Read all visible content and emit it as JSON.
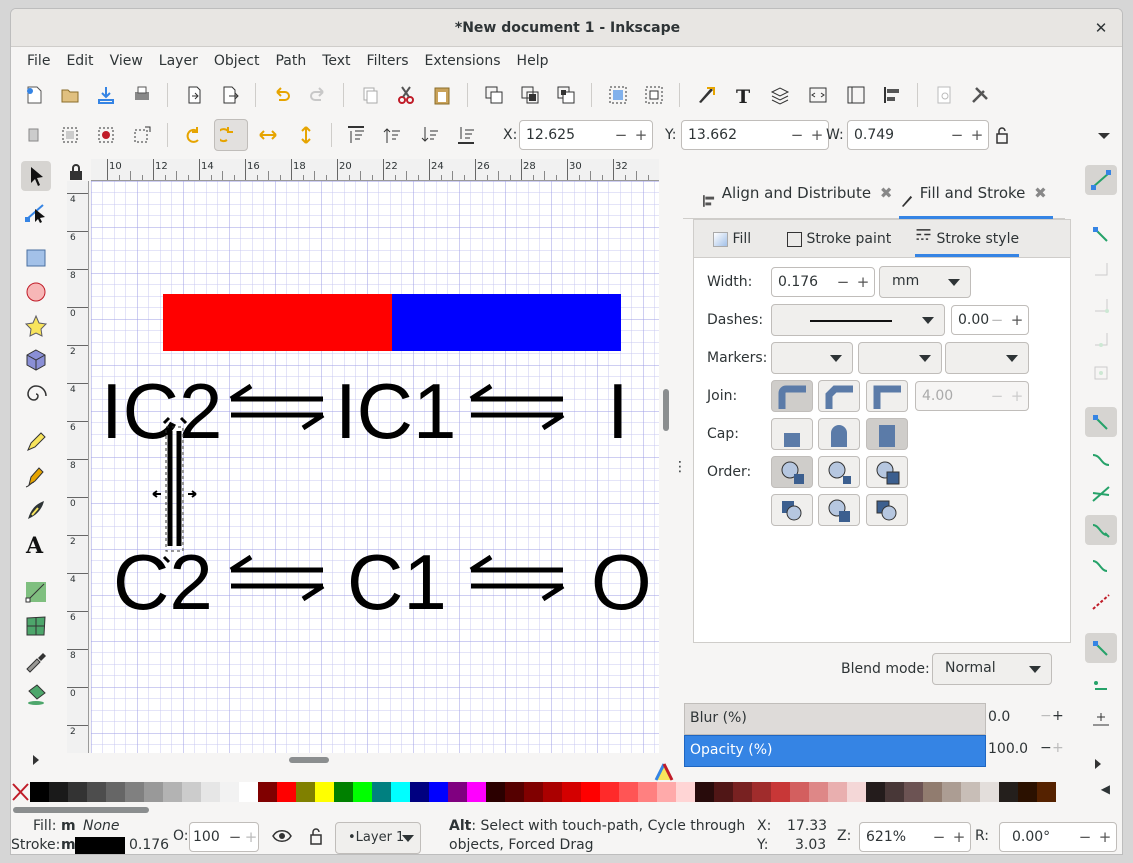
{
  "window": {
    "title": "*New document 1 - Inkscape",
    "close_glyph": "✕"
  },
  "menu": [
    "File",
    "Edit",
    "View",
    "Layer",
    "Object",
    "Path",
    "Text",
    "Filters",
    "Extensions",
    "Help"
  ],
  "toolctrl": {
    "x_label": "X:",
    "x_value": "12.625",
    "y_label": "Y:",
    "y_value": "13.662",
    "w_label": "W:",
    "w_value": "0.749"
  },
  "ruler_top_labels": [
    "10",
    "12",
    "14",
    "16",
    "18",
    "20",
    "22",
    "24",
    "26",
    "28",
    "30",
    "32",
    "3"
  ],
  "ruler_left_labels": [
    "4",
    "6",
    "8",
    "0",
    "2",
    "4",
    "6",
    "8",
    "0",
    "2",
    "4",
    "6",
    "8",
    "0",
    "2"
  ],
  "canvas": {
    "row1": [
      "IC2",
      "IC1",
      "I"
    ],
    "row2": [
      "C2",
      "C1",
      "O"
    ],
    "colors": {
      "red": "#ff0000",
      "blue": "#0000ff"
    }
  },
  "dock": {
    "tab_align": "Align and Distribute",
    "tab_fill_stroke": "Fill and Stroke",
    "subtab_fill": "Fill",
    "subtab_stroke_paint": "Stroke paint",
    "subtab_stroke_style": "Stroke style",
    "width_label": "Width:",
    "width_value": "0.176",
    "unit": "mm",
    "dashes_label": "Dashes:",
    "dashes_value": "0.00",
    "markers_label": "Markers:",
    "join_label": "Join:",
    "miter_value": "4.00",
    "cap_label": "Cap:",
    "order_label": "Order:",
    "blend_label": "Blend mode:",
    "blend_value": "Normal",
    "blur_label": "Blur (%)",
    "blur_value": "0.0",
    "opacity_label": "Opacity (%)",
    "opacity_value": "100.0",
    "accent": "#3584e4"
  },
  "palette": [
    "#000000",
    "#1a1a1a",
    "#333333",
    "#4d4d4d",
    "#666666",
    "#808080",
    "#999999",
    "#b3b3b3",
    "#cccccc",
    "#e6e6e6",
    "#f2f2f2",
    "#ffffff",
    "#800000",
    "#ff0000",
    "#808000",
    "#ffff00",
    "#008000",
    "#00ff00",
    "#008080",
    "#00ffff",
    "#000080",
    "#0000ff",
    "#800080",
    "#ff00ff",
    "#2b0000",
    "#550000",
    "#800000",
    "#aa0000",
    "#d40000",
    "#ff0000",
    "#ff2a2a",
    "#ff5555",
    "#ff8080",
    "#ffaaaa",
    "#ffd5d5",
    "#280b0b",
    "#501616",
    "#782121",
    "#a02c2c",
    "#c83737",
    "#d35f5f",
    "#de8787",
    "#e9afaf",
    "#f4d7d7",
    "#241c1c",
    "#483737",
    "#6c5353",
    "#917c6f",
    "#ac9d93",
    "#c8beb7",
    "#e3dedb",
    "#241f1c",
    "#2b1100",
    "#552200"
  ],
  "status": {
    "fill_label": "Fill:",
    "fill_m": "m",
    "fill_value": "None",
    "stroke_label": "Stroke:",
    "stroke_m": "m",
    "stroke_width": "0.176",
    "o_label": "O:",
    "o_value": "100",
    "layer": "•Layer 1",
    "msg_bold": "Alt",
    "msg_line1": ": Select with touch-path, Cycle through",
    "msg_line2": "objects, Forced Drag",
    "cx_label": "X:",
    "cx_value": "17.33",
    "cy_label": "Y:",
    "cy_value": "3.03",
    "zoom_label": "Z:",
    "zoom_value": "621%",
    "rot_label": "R:",
    "rot_value": "0.00°"
  }
}
